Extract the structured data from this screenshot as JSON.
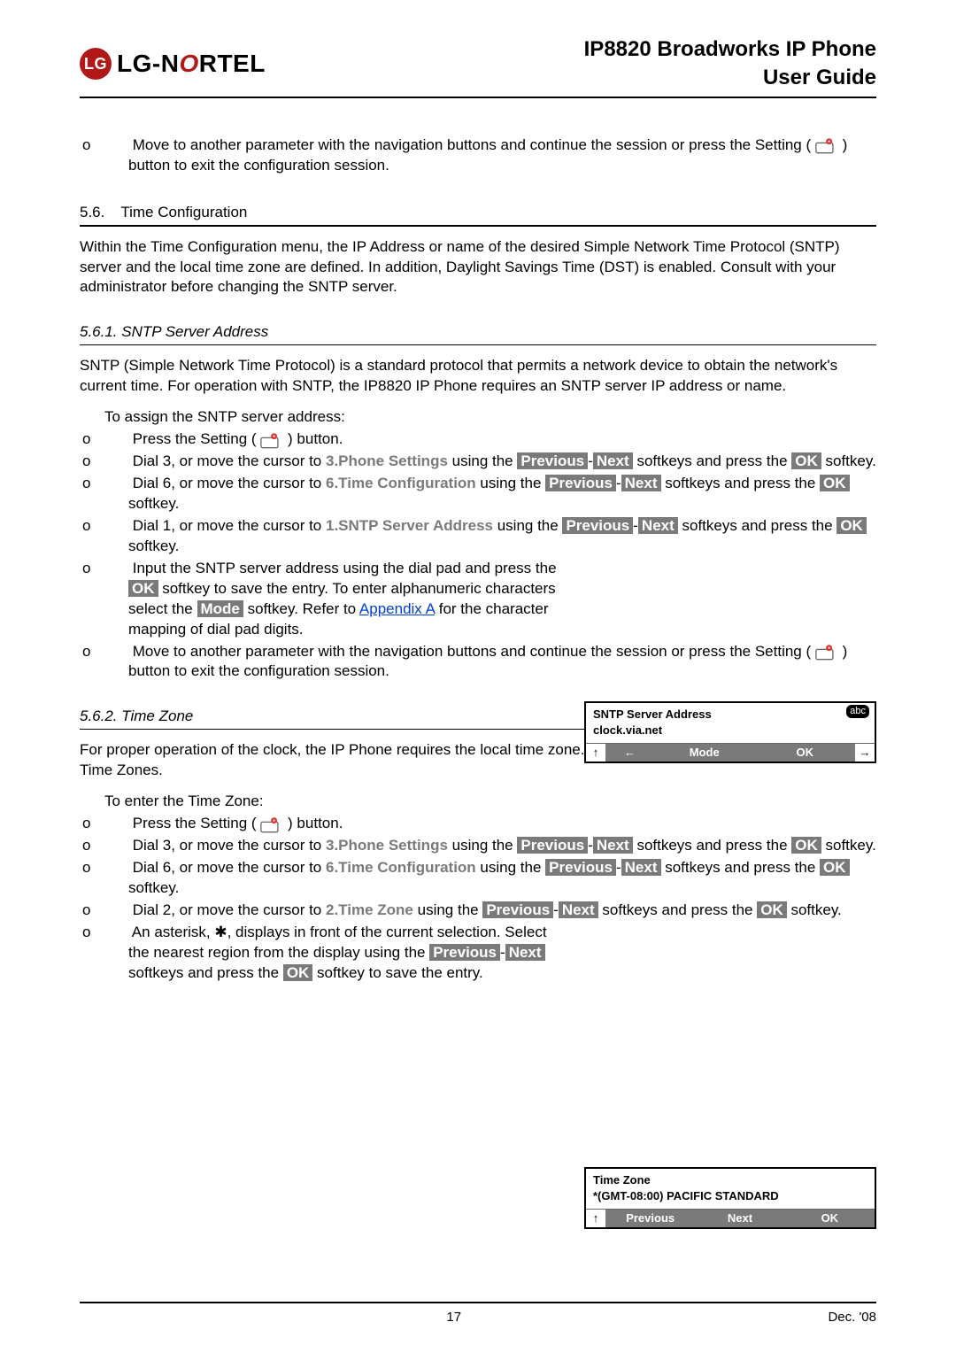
{
  "header": {
    "logo_text_left": "LG",
    "logo_text_sep": "-",
    "logo_text_right": "N",
    "logo_text_o": "O",
    "logo_text_tail": "RTEL",
    "title_line1": "IP8820 Broadworks IP Phone",
    "title_line2": "User Guide"
  },
  "intro_bullet": "Move to another parameter with the navigation buttons and continue the session or press the Setting (",
  "intro_bullet_tail": ") button to exit the configuration session.",
  "s56": {
    "num": "5.6.",
    "title": "Time Configuration"
  },
  "s56_para": "Within the Time Configuration menu, the IP Address or name of the desired Simple Network Time Protocol (SNTP) server and the local time zone are defined.  In addition, Daylight Savings Time (DST) is enabled.  Consult with your administrator before changing the SNTP server.",
  "s561": {
    "head": "5.6.1.  SNTP Server Address"
  },
  "s561_para": "SNTP (Simple Network Time Protocol) is a standard protocol that permits a network device to obtain the network's current time.  For operation with SNTP, the IP8820 IP Phone requires an SNTP server IP address or name.",
  "s561_intro": "To assign the SNTP server address:",
  "li": {
    "press_setting_a": "Press the Setting (",
    "press_setting_b": ") button.",
    "dial3_a": "Dial 3, or move the cursor to ",
    "m3": "3.Phone Settings",
    "using": " using the ",
    "prev": "Previous",
    "dash": "-",
    "next": "Next",
    "soft_press": " softkeys and press the ",
    "ok": "OK",
    "softkey_dot": " softkey.",
    "dial6_a": "Dial 6, or move the cursor to ",
    "m6": "6.Time Configuration",
    "soft_press_the": " softkeys and press the ",
    "dial1_a": "Dial 1, or move the cursor to ",
    "m1": "1.SNTP Server Address",
    "soft_and_press": " softkeys and press the ",
    "input_a": "Input the SNTP server address using the dial pad and press the ",
    "input_b": " softkey to save the entry.  To enter alphanumeric characters select the ",
    "mode": "Mode",
    "input_c": " softkey.  Refer to ",
    "appendixA": "Appendix A",
    "input_d": " for the character mapping of dial pad digits.",
    "move_a": "Move to another parameter with the navigation buttons and continue the session or press the Setting (",
    "move_b": ") button to exit the configuration session."
  },
  "s562": {
    "head": "5.6.2.  Time Zone"
  },
  "s562_para": "For proper operation of the clock, the IP Phone requires the local time zone.  For available time zones, see Appendix B Time Zones.",
  "s562_intro": "To enter the Time Zone:",
  "tz": {
    "dial2_a": "Dial 2, or move the cursor to ",
    "m2": "2.Time Zone",
    "soft_press_ok": " softkeys and press the ",
    "ast_a": "An asterisk, ",
    "ast_sym": "✱",
    "ast_b": ", displays in front of the current selection.  Select the nearest region from the display using the ",
    "ast_c": " softkeys and press the ",
    "ast_d": " softkey to save the entry."
  },
  "phonebox1": {
    "line1": "SNTP Server Address",
    "line2": "clock.via.net",
    "abc": "abc",
    "k_up": "↑",
    "k_left": "←",
    "k_mode": "Mode",
    "k_ok": "OK",
    "k_right": "→"
  },
  "phonebox2": {
    "line1": "Time Zone",
    "line2": "*(GMT-08:00) PACIFIC STANDARD",
    "k_up": "↑",
    "k_prev": "Previous",
    "k_next": "Next",
    "k_ok": "OK"
  },
  "footer": {
    "page": "17",
    "date": "Dec. '08"
  }
}
